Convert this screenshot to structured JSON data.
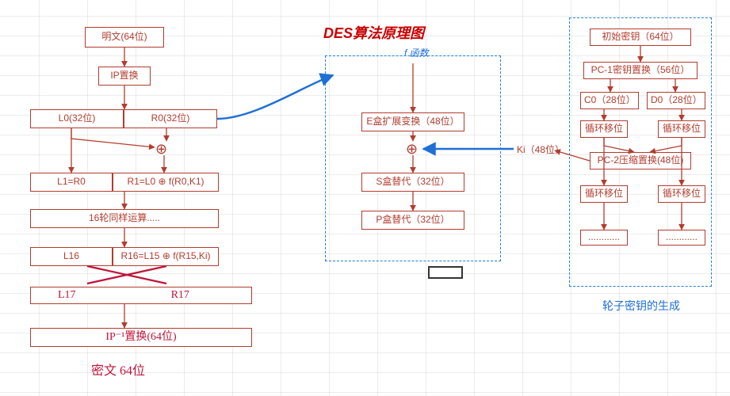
{
  "title": "DES算法原理图",
  "f_label": "f 函数",
  "left": {
    "plaintext": "明文(64位)",
    "ip": "IP置换",
    "L0": "L0(32位)",
    "R0": "R0(32位)",
    "L1": "L1=R0",
    "R1": "R1=L0 ⊕ f(R0,K1)",
    "rounds": "16轮同样运算.....",
    "L16": "L16",
    "R16": "R16=L15 ⊕ f(R15,Ki)"
  },
  "xor": "⊕",
  "hand": {
    "L17": "L17",
    "R17": "R17",
    "ip_inv": "IP⁻¹置换(64位)",
    "cipher": "密文 64位"
  },
  "center": {
    "E": "E盒扩展变换（48位）",
    "S": "S盒替代（32位）",
    "P": "P盒替代（32位）"
  },
  "K_label": "Ki（48位）",
  "right": {
    "init_key": "初始密钥（64位）",
    "pc1": "PC-1密钥置换（56位）",
    "C0": "C0（28位）",
    "D0": "D0（28位）",
    "shift": "循环移位",
    "pc2": "PC-2压缩置换(48位)",
    "dots": "............"
  },
  "key_gen_label": "轮子密钥的生成"
}
